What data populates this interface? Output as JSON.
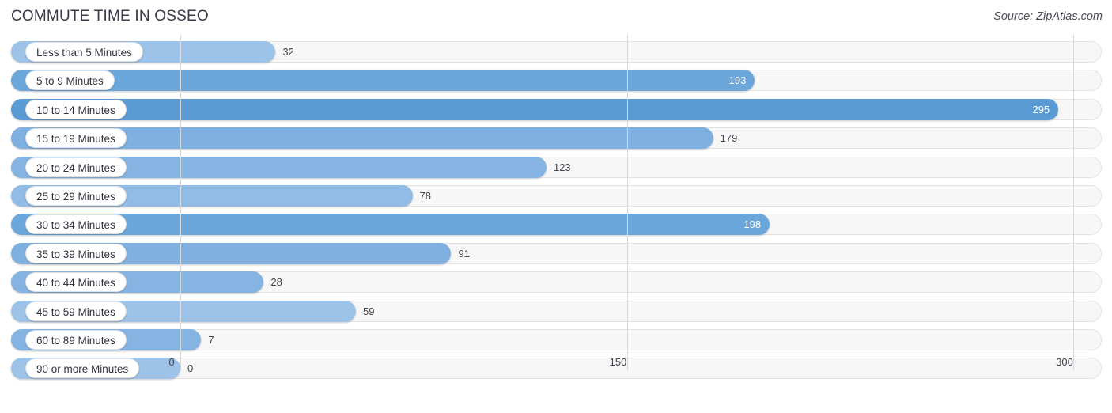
{
  "header": {
    "title": "COMMUTE TIME IN OSSEO",
    "source": "Source: ZipAtlas.com"
  },
  "axis": {
    "ticks": [
      "0",
      "150",
      "300"
    ]
  },
  "colors": {
    "bar_light": "#9dc3e8",
    "bar_mid": "#7fb0e0",
    "bar_dark": "#5b9bd5",
    "track": "#f7f7f7",
    "grid": "#d8d8d8",
    "text": "#44444e",
    "title": "#3a3a48"
  },
  "chart_data": {
    "type": "bar",
    "orientation": "horizontal",
    "title": "COMMUTE TIME IN OSSEO",
    "xlabel": "",
    "ylabel": "",
    "xlim": [
      0,
      300
    ],
    "xticks": [
      0,
      150,
      300
    ],
    "grid": true,
    "legend": "none",
    "source": "Source: ZipAtlas.com",
    "categories": [
      "Less than 5 Minutes",
      "5 to 9 Minutes",
      "10 to 14 Minutes",
      "15 to 19 Minutes",
      "20 to 24 Minutes",
      "25 to 29 Minutes",
      "30 to 34 Minutes",
      "35 to 39 Minutes",
      "40 to 44 Minutes",
      "45 to 59 Minutes",
      "60 to 89 Minutes",
      "90 or more Minutes"
    ],
    "values": [
      32,
      193,
      295,
      179,
      123,
      78,
      198,
      91,
      28,
      59,
      7,
      0
    ],
    "value_labels": [
      "32",
      "193",
      "295",
      "179",
      "123",
      "78",
      "198",
      "91",
      "28",
      "59",
      "7",
      "0"
    ],
    "bars": [
      {
        "label": "Less than 5 Minutes",
        "value": 32,
        "value_label": "32",
        "color": "#9dc3e8",
        "label_inside": false
      },
      {
        "label": "5 to 9 Minutes",
        "value": 193,
        "value_label": "193",
        "color": "#6ca7dc",
        "label_inside": true
      },
      {
        "label": "10 to 14 Minutes",
        "value": 295,
        "value_label": "295",
        "color": "#5b9bd5",
        "label_inside": true
      },
      {
        "label": "15 to 19 Minutes",
        "value": 179,
        "value_label": "179",
        "color": "#7fb0e0",
        "label_inside": false
      },
      {
        "label": "20 to 24 Minutes",
        "value": 123,
        "value_label": "123",
        "color": "#85b4e2",
        "label_inside": false
      },
      {
        "label": "25 to 29 Minutes",
        "value": 78,
        "value_label": "78",
        "color": "#91bce5",
        "label_inside": false
      },
      {
        "label": "30 to 34 Minutes",
        "value": 198,
        "value_label": "198",
        "color": "#6ca7dc",
        "label_inside": true
      },
      {
        "label": "35 to 39 Minutes",
        "value": 91,
        "value_label": "91",
        "color": "#7fb0e0",
        "label_inside": false
      },
      {
        "label": "40 to 44 Minutes",
        "value": 28,
        "value_label": "28",
        "color": "#85b4e2",
        "label_inside": false
      },
      {
        "label": "45 to 59 Minutes",
        "value": 59,
        "value_label": "59",
        "color": "#9dc3e8",
        "label_inside": false
      },
      {
        "label": "60 to 89 Minutes",
        "value": 7,
        "value_label": "7",
        "color": "#85b4e2",
        "label_inside": false
      },
      {
        "label": "90 or more Minutes",
        "value": 0,
        "value_label": "0",
        "color": "#9dc3e8",
        "label_inside": false
      }
    ]
  }
}
